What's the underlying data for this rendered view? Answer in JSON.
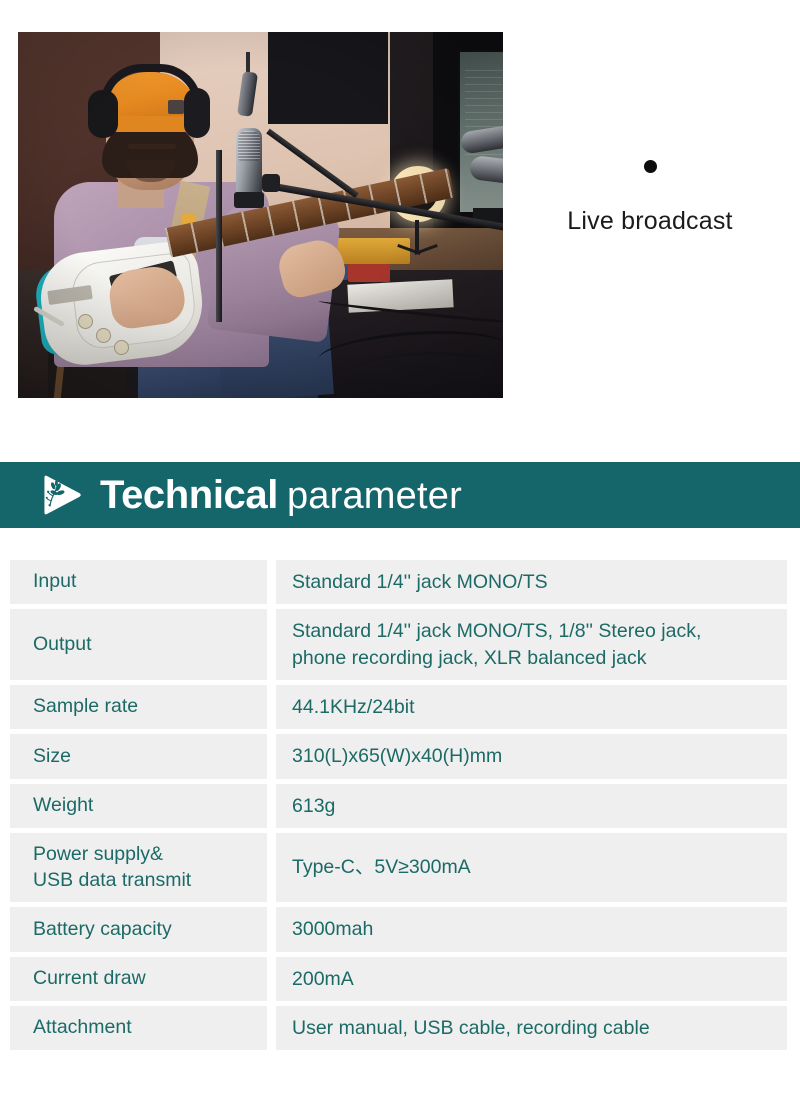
{
  "hero": {
    "photo_alt": "Guitarist with orange beanie and headphones playing electric guitar in a home recording studio with microphone, ring light and monitor",
    "caption": {
      "bullet": "bullet-dot",
      "label": "Live broadcast"
    }
  },
  "section": {
    "icon": "play-triangle-floral-icon",
    "title_bold": "Technical",
    "title_light": "parameter",
    "banner_color": "#15666b"
  },
  "spec_table": {
    "row_bg": "#efefef",
    "text_color": "#1c6a66",
    "rows": [
      {
        "label": "Input",
        "value": "Standard 1/4'' jack MONO/TS",
        "size": "short"
      },
      {
        "label": "Output",
        "value": "Standard 1/4'' jack MONO/TS, 1/8'' Stereo jack,\nphone recording jack, XLR balanced jack",
        "size": "tall"
      },
      {
        "label": "Sample rate",
        "value": "44.1KHz/24bit",
        "size": "short"
      },
      {
        "label": "Size",
        "value": "310(L)x65(W)x40(H)mm",
        "size": "short"
      },
      {
        "label": "Weight",
        "value": "613g",
        "size": "short"
      },
      {
        "label": "Power supply&\nUSB data transmit",
        "value": "Type-C、5V≥300mA",
        "size": "tall"
      },
      {
        "label": "Battery capacity",
        "value": "3000mah",
        "size": "short"
      },
      {
        "label": "Current draw",
        "value": "200mA",
        "size": "short"
      },
      {
        "label": "Attachment",
        "value": "User manual, USB cable, recording cable",
        "size": "short"
      }
    ]
  }
}
